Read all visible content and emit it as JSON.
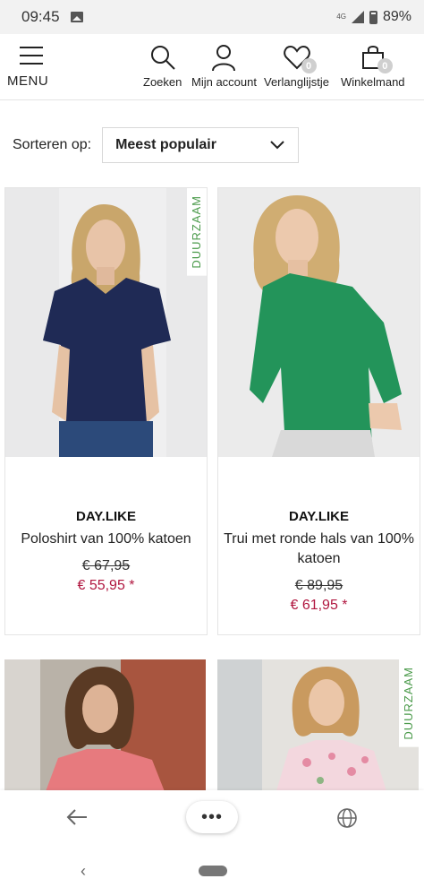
{
  "status": {
    "time": "09:45",
    "network": "4G",
    "battery": "89%"
  },
  "nav": {
    "menu_label": "MENU",
    "search_label": "Zoeken",
    "account_label": "Mijn account",
    "wishlist_label": "Verlanglijstje",
    "wishlist_count": "0",
    "cart_label": "Winkelmand",
    "cart_count": "0"
  },
  "sort": {
    "label": "Sorteren op:",
    "value": "Meest populair"
  },
  "sustain_tag": "DUURZAAM",
  "products": [
    {
      "brand": "DAY.LIKE",
      "name": "Poloshirt van 100% katoen",
      "old_price": "€ 67,95",
      "new_price": "€ 55,95 *",
      "sustainable": true
    },
    {
      "brand": "DAY.LIKE",
      "name": "Trui met ronde hals van 100% katoen",
      "old_price": "€ 89,95",
      "new_price": "€ 61,95 *",
      "sustainable": false
    },
    {
      "sustainable": false
    },
    {
      "sustainable": true
    }
  ],
  "browser": {
    "more_label": "•••"
  },
  "colors": {
    "accent_price": "#b0163f",
    "sustain_green": "#4a9a4a"
  }
}
